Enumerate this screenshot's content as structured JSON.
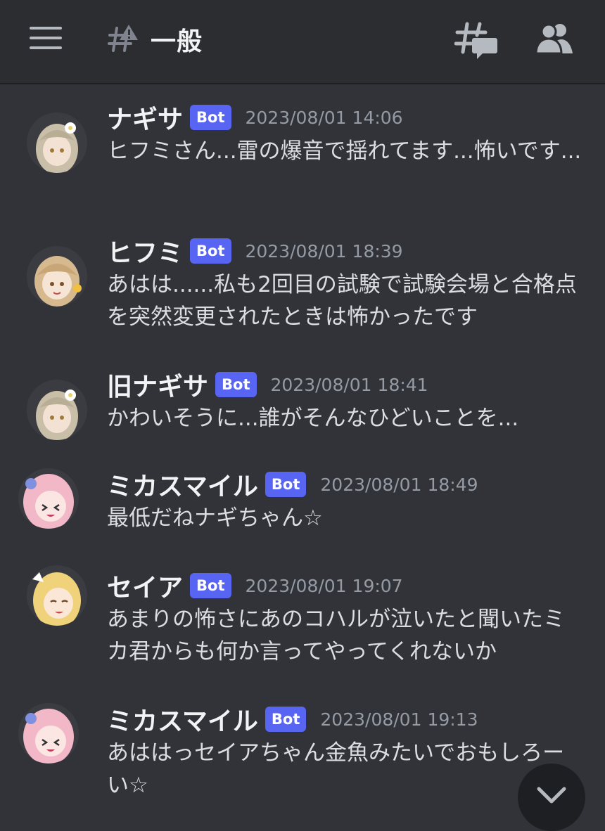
{
  "header": {
    "channel_name": "一般",
    "menu_icon": "hamburger-menu-icon",
    "channel_icon": "text-channel-rules-icon",
    "threads_icon": "threads-icon",
    "members_icon": "members-icon"
  },
  "colors": {
    "background": "#313338",
    "header_bg": "#2b2d31",
    "bot_badge": "#5865f2",
    "timestamp": "#949ba4"
  },
  "messages": [
    {
      "username": "ナギサ",
      "badge": "Bot",
      "timestamp": "2023/08/01 14:06",
      "text": "ヒフミさん...雷の爆音で揺れてます...怖いです..."
    },
    {
      "username": "ヒフミ",
      "badge": "Bot",
      "timestamp": "2023/08/01 18:39",
      "text": "あはは......私も2回目の試験で試験会場と合格点を突然変更されたときは怖かったです"
    },
    {
      "username": "旧ナギサ",
      "badge": "Bot",
      "timestamp": "2023/08/01 18:41",
      "text": "かわいそうに...誰がそんなひどいことを..."
    },
    {
      "username": "ミカスマイル",
      "badge": "Bot",
      "timestamp": "2023/08/01 18:49",
      "text": "最低だねナギちゃん☆"
    },
    {
      "username": "セイア",
      "badge": "Bot",
      "timestamp": "2023/08/01 19:07",
      "text": "あまりの怖さにあのコハルが泣いたと聞いたミカ君からも何か言ってやってくれないか"
    },
    {
      "username": "ミカスマイル",
      "badge": "Bot",
      "timestamp": "2023/08/01 19:13",
      "text": "あははっセイアちゃん金魚みたいでおもしろーい☆"
    }
  ],
  "scroll_button": {
    "icon": "chevron-down-icon"
  }
}
